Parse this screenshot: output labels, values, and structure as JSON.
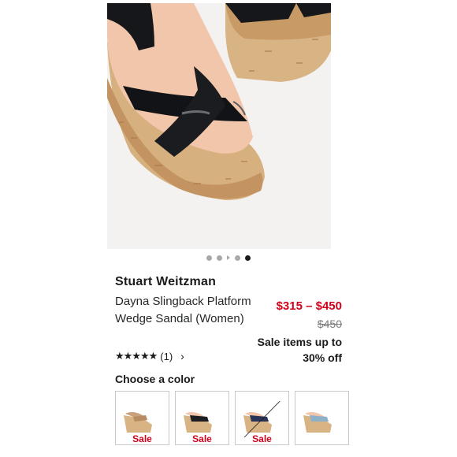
{
  "product": {
    "brand": "Stuart Weitzman",
    "name": "Dayna Slingback Platform Wedge Sandal (Women)",
    "price_range": "$315 – $450",
    "original_price": "$450",
    "sale_note": "Sale items up to 30% off",
    "rating_count": "(1)",
    "rating_value": 5
  },
  "gallery": {
    "image_count": 5,
    "active_index": 5,
    "image_icon": "shoe-product-photo"
  },
  "colors": {
    "heading": "Choose a color",
    "swatches": [
      {
        "badge": "Sale",
        "unavailable": false,
        "color": "#c9a27d"
      },
      {
        "badge": "Sale",
        "unavailable": false,
        "color": "#1d1e22"
      },
      {
        "badge": "Sale",
        "unavailable": true,
        "color": "#2a3358"
      },
      {
        "badge": "",
        "unavailable": false,
        "color": "#8fb0c9"
      }
    ]
  },
  "icons": {
    "star": "star-icon",
    "chevron": "chevron-right-icon"
  },
  "accent": {
    "sale_red": "#d0021b",
    "text_dark": "#191a1b"
  }
}
